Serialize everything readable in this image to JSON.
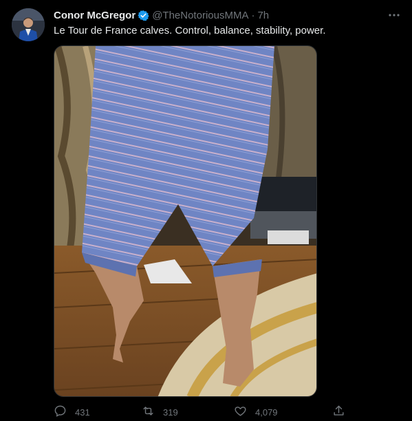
{
  "tweet": {
    "author_name": "Conor McGregor",
    "handle": "@TheNotoriousMMA",
    "separator": "·",
    "time": "7h",
    "text": "Le Tour de France calves. Control, balance, stability, power."
  },
  "actions": {
    "replies": "431",
    "retweets": "319",
    "likes": "4,079"
  },
  "colors": {
    "background": "#000000",
    "primary_text": "#e7e9ea",
    "secondary_text": "#71767b",
    "verified_badge": "#1d9bf0"
  },
  "icons": [
    "verified-icon",
    "more-icon",
    "reply-icon",
    "retweet-icon",
    "like-icon",
    "share-icon"
  ]
}
